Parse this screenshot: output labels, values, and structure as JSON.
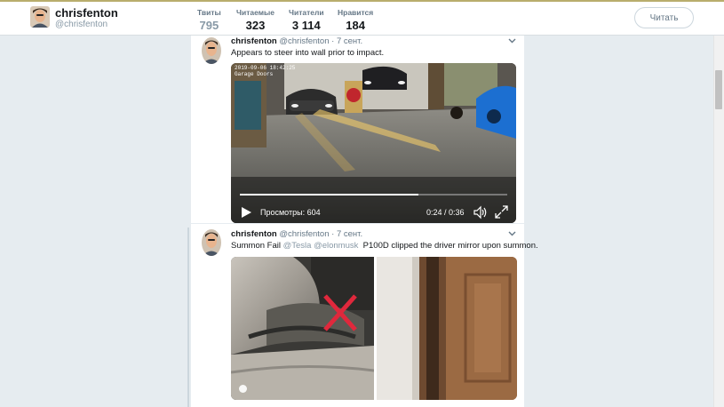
{
  "profile": {
    "name": "chrisfenton",
    "handle": "@chrisfenton",
    "follow_label": "Читать"
  },
  "stats": [
    {
      "label": "Твиты",
      "value": "795"
    },
    {
      "label": "Читаемые",
      "value": "323"
    },
    {
      "label": "Читатели",
      "value": "3 114"
    },
    {
      "label": "Нравится",
      "value": "184"
    }
  ],
  "tweets": [
    {
      "name": "chrisfenton",
      "handle": "@chrisfenton",
      "date": "· 7 сент.",
      "text": "Appears to steer into wall prior to impact.",
      "video": {
        "camera_stamp_line1": "2019-09-06 18:42:25",
        "camera_stamp_line2": "Garage Doors",
        "views": "Просмотры: 604",
        "time": "0:24 / 0:36",
        "progress": 0.667
      }
    },
    {
      "name": "chrisfenton",
      "handle": "@chrisfenton",
      "date": "· 7 сент.",
      "text_prefix": "Summon Fail ",
      "mention1": "@Tesla",
      "mention2": "@elonmusk",
      "text_suffix": "  P100D clipped the driver mirror upon summon."
    }
  ],
  "colors": {
    "accent_bar": "#b9ad6d",
    "background": "#e6ecf0",
    "mention": "#8899a6",
    "red_x": "#e0283c"
  },
  "icons": [
    "avatar",
    "chevron-down-icon",
    "play-icon",
    "volume-icon",
    "fullscreen-icon"
  ]
}
